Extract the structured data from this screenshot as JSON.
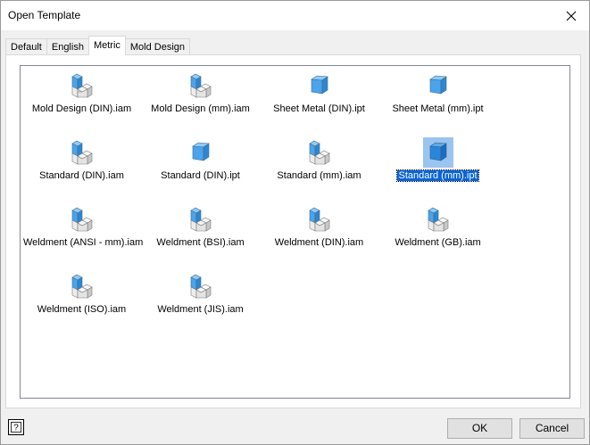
{
  "window": {
    "title": "Open Template"
  },
  "tabs": [
    {
      "label": "Default",
      "active": false
    },
    {
      "label": "English",
      "active": false
    },
    {
      "label": "Metric",
      "active": true
    },
    {
      "label": "Mold Design",
      "active": false
    }
  ],
  "templates": [
    {
      "label": "Mold Design (DIN).iam",
      "icon": "assembly-icon"
    },
    {
      "label": "Mold Design (mm).iam",
      "icon": "assembly-icon"
    },
    {
      "label": "Sheet Metal (DIN).ipt",
      "icon": "sheet-metal-part-icon"
    },
    {
      "label": "Sheet Metal (mm).ipt",
      "icon": "sheet-metal-part-icon"
    },
    {
      "label": "Standard (DIN).iam",
      "icon": "assembly-icon"
    },
    {
      "label": "Standard (DIN).ipt",
      "icon": "part-icon"
    },
    {
      "label": "Standard (mm).iam",
      "icon": "assembly-icon"
    },
    {
      "label": "Standard (mm).ipt",
      "icon": "part-icon",
      "selected": true
    },
    {
      "label": "Weldment (ANSI - mm).iam",
      "icon": "assembly-icon"
    },
    {
      "label": "Weldment (BSI).iam",
      "icon": "assembly-icon"
    },
    {
      "label": "Weldment (DIN).iam",
      "icon": "assembly-icon"
    },
    {
      "label": "Weldment (GB).iam",
      "icon": "assembly-icon"
    },
    {
      "label": "Weldment (ISO).iam",
      "icon": "assembly-icon"
    },
    {
      "label": "Weldment (JIS).iam",
      "icon": "assembly-icon"
    }
  ],
  "buttons": {
    "ok": "OK",
    "cancel": "Cancel",
    "help": "?"
  },
  "colors": {
    "accent": "#0a64d8",
    "cube": "#4ba3ea",
    "selection_tint": "#9bc4f0"
  }
}
